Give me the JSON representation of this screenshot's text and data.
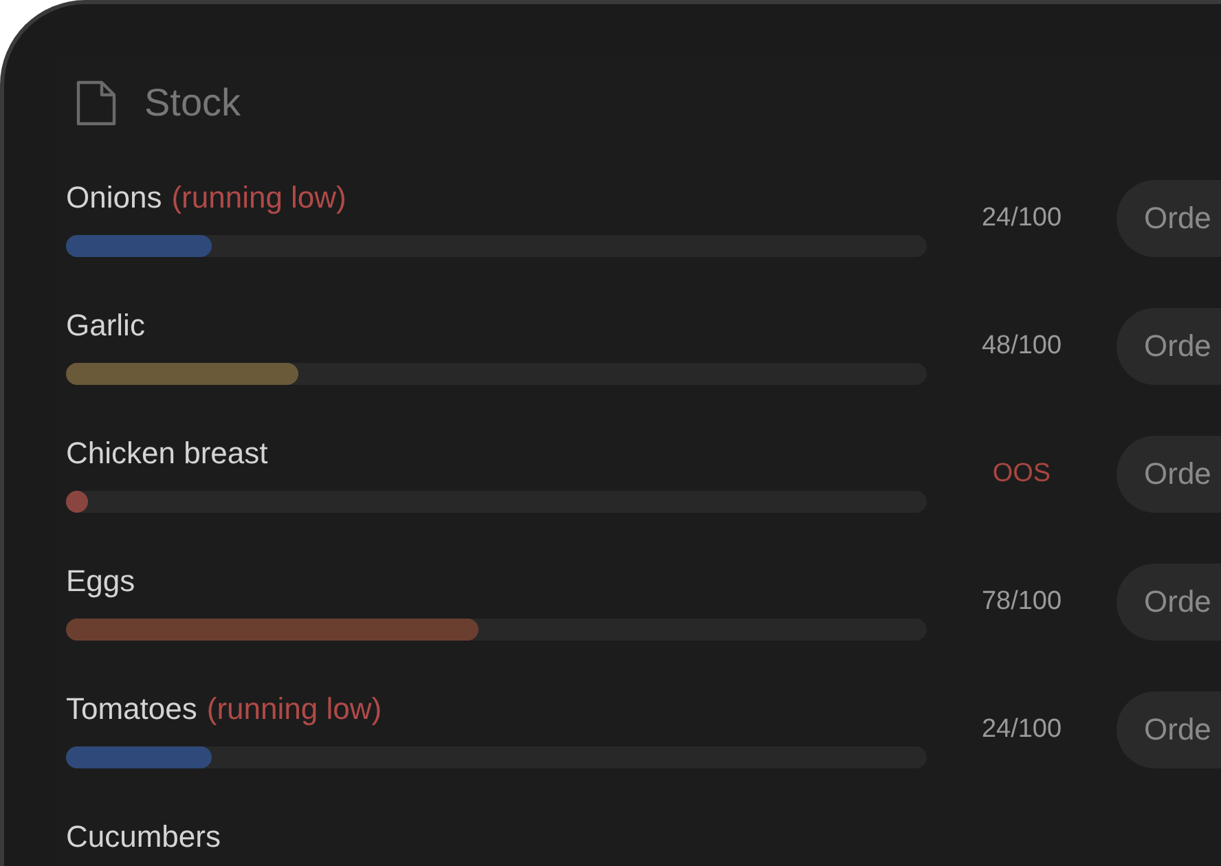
{
  "panel": {
    "title": "Stock"
  },
  "items": [
    {
      "name": "Onions",
      "note": "(running low)",
      "level": 0.17,
      "color": "#2f4a7a",
      "count": "24/100",
      "alert": false,
      "button": "Orde"
    },
    {
      "name": "Garlic",
      "level": 0.27,
      "color": "#6b5a3a",
      "count": "48/100",
      "alert": false,
      "button": "Orde"
    },
    {
      "name": "Chicken breast",
      "level": 0.026,
      "color": "#8b4540",
      "count": "OOS",
      "alert": true,
      "button": "Orde"
    },
    {
      "name": "Eggs",
      "level": 0.48,
      "color": "#6b3f2f",
      "count": "78/100",
      "alert": false,
      "button": "Orde"
    },
    {
      "name": "Tomatoes",
      "note": "(running low)",
      "level": 0.17,
      "color": "#2f4a7a",
      "count": "24/100",
      "alert": false,
      "button": "Orde"
    },
    {
      "name": "Cucumbers"
    }
  ]
}
